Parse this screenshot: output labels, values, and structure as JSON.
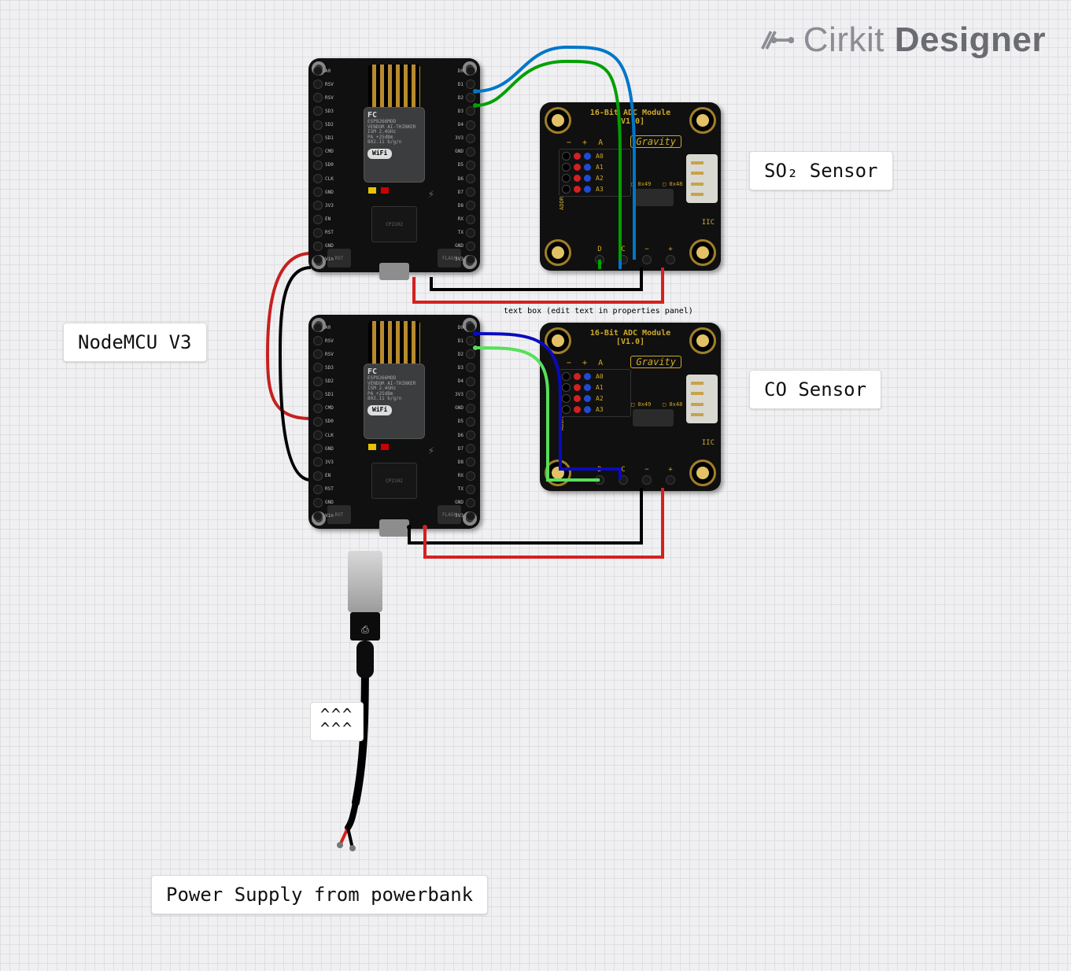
{
  "brand": {
    "name": "Cirkit",
    "suffix": "Designer"
  },
  "labels": {
    "nodemcu": "NodeMCU V3",
    "so2": "SO₂ Sensor",
    "co": "CO Sensor",
    "power": "Power Supply from powerbank",
    "arrows": "^^^\n^^^",
    "hint": "text box (edit text in properties panel)"
  },
  "mcu": {
    "shield_text": "ESP8266MOD\nVENDOR AI-THINKER\nISM 2.4GHz\nPA +25dBm\n802.11 b/g/n",
    "fcc": "FC",
    "wifi": "WiFi",
    "chip": "CP2102",
    "btn_rst": "RST",
    "btn_flash": "FLASH",
    "pins_left": [
      "A0",
      "RSV",
      "RSV",
      "SD3",
      "SD2",
      "SD1",
      "CMD",
      "SD0",
      "CLK",
      "GND",
      "3V3",
      "EN",
      "RST",
      "GND",
      "Vin"
    ],
    "pins_right": [
      "D0",
      "D1",
      "D2",
      "D3",
      "D4",
      "3V3",
      "GND",
      "D5",
      "D6",
      "D7",
      "D8",
      "RX",
      "TX",
      "GND",
      "3V3"
    ]
  },
  "adc": {
    "title": "16-Bit ADC Module\n[V1.0]",
    "gravity": "Gravity",
    "addr1": "0x49",
    "addr2": "0x48",
    "addrv": "ADDR",
    "iic": "IIC",
    "top_labels": [
      "−",
      "+",
      "A"
    ],
    "analog": [
      "A0",
      "A1",
      "A2",
      "A3"
    ],
    "i2c": [
      "D",
      "C",
      "−",
      "+"
    ]
  }
}
